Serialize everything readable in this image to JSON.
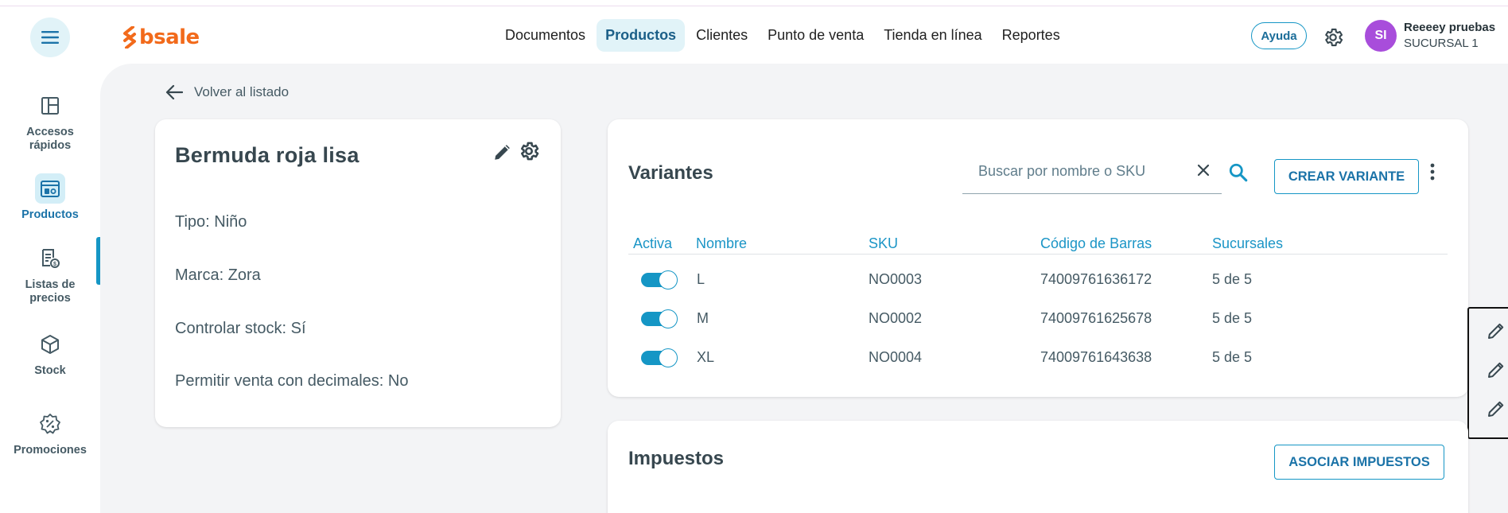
{
  "header": {
    "logo_text": "bsale",
    "nav": [
      "Documentos",
      "Productos",
      "Clientes",
      "Punto de venta",
      "Tienda en línea",
      "Reportes"
    ],
    "help_label": "Ayuda",
    "avatar_initials": "SI",
    "user_name": "Reeeey pruebas",
    "user_branch": "SUCURSAL 1"
  },
  "sidebar": {
    "items": [
      {
        "label": "Accesos rápidos",
        "icon": "quick-access-icon"
      },
      {
        "label": "Productos",
        "icon": "products-icon",
        "active": true
      },
      {
        "label": "Listas de precios",
        "icon": "price-list-icon"
      },
      {
        "label": "Stock",
        "icon": "stock-box-icon"
      },
      {
        "label": "Promociones",
        "icon": "promotion-badge-icon"
      }
    ]
  },
  "back_label": "Volver al listado",
  "product": {
    "title": "Bermuda roja lisa",
    "attributes": [
      "Tipo: Niño",
      "Marca: Zora",
      "Controlar stock: Sí",
      "Permitir venta con decimales: No"
    ]
  },
  "variants": {
    "title": "Variantes",
    "search_placeholder": "Buscar por nombre o SKU",
    "create_label": "CREAR VARIANTE",
    "columns": [
      "Activa",
      "Nombre",
      "SKU",
      "Código de Barras",
      "Sucursales"
    ],
    "rows": [
      {
        "active": true,
        "name": "L",
        "sku": "NO0003",
        "barcode": "74009761636172",
        "branches": "5 de 5"
      },
      {
        "active": true,
        "name": "M",
        "sku": "NO0002",
        "barcode": "74009761625678",
        "branches": "5 de 5"
      },
      {
        "active": true,
        "name": "XL",
        "sku": "NO0004",
        "barcode": "74009761643638",
        "branches": "5 de 5"
      }
    ]
  },
  "taxes": {
    "title": "Impuestos",
    "associate_label": "ASOCIAR IMPUESTOS"
  },
  "colors": {
    "accent": "#1596c5",
    "brand": "#f26a1b",
    "avatar": "#a84ddb",
    "nav_active_bg": "#e1f3f8"
  }
}
